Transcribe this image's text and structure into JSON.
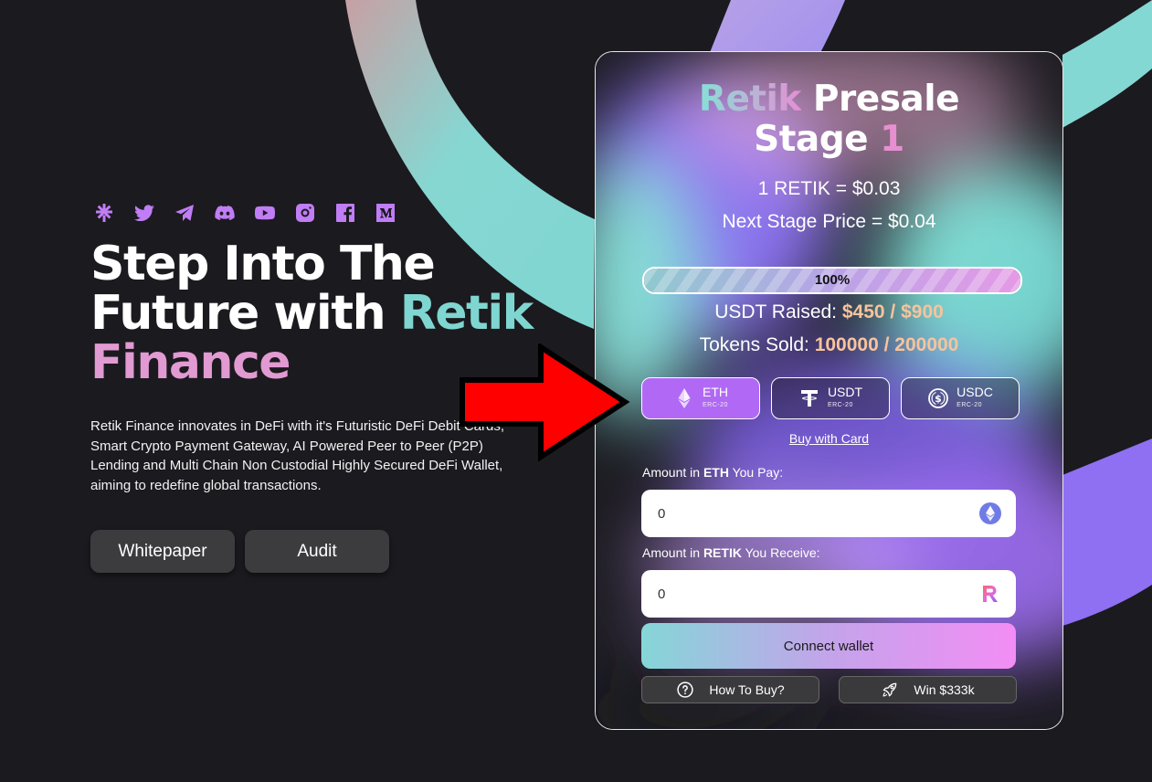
{
  "hero": {
    "title_line1": "Step Into The",
    "title_line2a": "Future with ",
    "title_line2b": "Retik",
    "title_line3": "Finance",
    "description": "Retik Finance innovates in DeFi with it's Futuristic DeFi Debit Cards, Smart Crypto Payment Gateway, AI Powered Peer to Peer (P2P) Lending and Multi Chain Non Custodial Highly Secured DeFi Wallet, aiming to redefine global transactions.",
    "buttons": {
      "whitepaper": "Whitepaper",
      "audit": "Audit"
    },
    "socials": [
      "linktree-icon",
      "twitter-icon",
      "telegram-icon",
      "discord-icon",
      "youtube-icon",
      "instagram-icon",
      "facebook-icon",
      "medium-icon"
    ]
  },
  "presale": {
    "title_a": "Retik",
    "title_b": " Presale",
    "title_c": "Stage ",
    "title_d": "1",
    "price": "1 RETIK = $0.03",
    "next_price": "Next Stage Price = $0.04",
    "progress": {
      "percent": 100,
      "label": "100%"
    },
    "usdt_raised_label": "USDT Raised: ",
    "usdt_raised_value": "$450 / $900",
    "tokens_sold_label": "Tokens Sold: ",
    "tokens_sold_value": "100000 / 200000",
    "pay_options": [
      {
        "name": "ETH",
        "network": "ERC-20",
        "active": true
      },
      {
        "name": "USDT",
        "network": "ERC-20",
        "active": false
      },
      {
        "name": "USDC",
        "network": "ERC-20",
        "active": false
      }
    ],
    "buy_with_card": "Buy with Card",
    "pay_label_a": "Amount in ",
    "pay_label_b": "ETH",
    "pay_label_c": " You Pay:",
    "pay_value": "0",
    "recv_label_a": "Amount in ",
    "recv_label_b": "RETIK",
    "recv_label_c": " You Receive:",
    "recv_value": "0",
    "connect": "Connect wallet",
    "how_to_buy": "How To Buy?",
    "win": "Win $333k"
  },
  "colors": {
    "background": "#1b1a1f",
    "teal": "#7fd6d0",
    "pink": "#e19ad2",
    "purple": "#b169f5",
    "accent_value": "#f9c39c",
    "arrow": "#ff0000"
  }
}
